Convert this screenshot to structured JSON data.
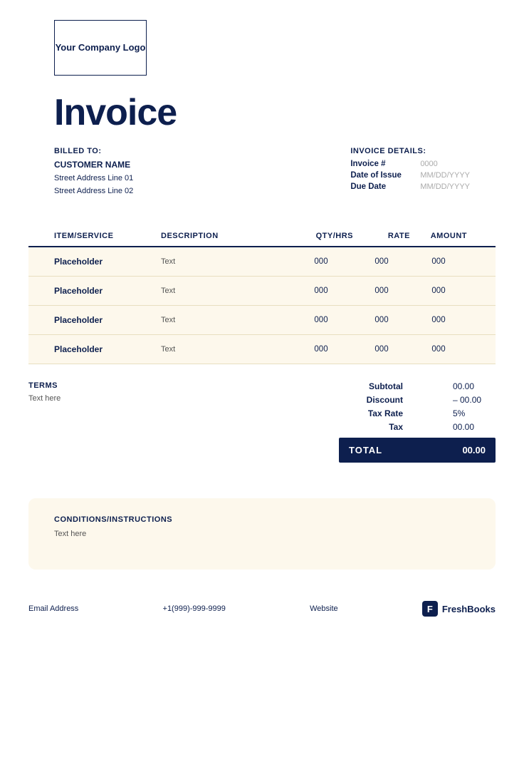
{
  "logo": {
    "text": "Your Company Logo"
  },
  "invoice": {
    "title": "Invoice"
  },
  "billed_to": {
    "label": "BILLED TO:",
    "customer_name": "CUSTOMER NAME",
    "address_line1": "Street Address Line 01",
    "address_line2": "Street Address Line 02"
  },
  "invoice_details": {
    "label": "INVOICE DETAILS:",
    "number_key": "Invoice #",
    "number_val": "0000",
    "issue_key": "Date of Issue",
    "issue_val": "MM/DD/YYYY",
    "due_key": "Due Date",
    "due_val": "MM/DD/YYYY"
  },
  "table": {
    "headers": [
      "ITEM/SERVICE",
      "DESCRIPTION",
      "QTY/HRS",
      "RATE",
      "AMOUNT"
    ],
    "rows": [
      {
        "item": "Placeholder",
        "description": "Text",
        "qty": "000",
        "rate": "000",
        "amount": "000"
      },
      {
        "item": "Placeholder",
        "description": "Text",
        "qty": "000",
        "rate": "000",
        "amount": "000"
      },
      {
        "item": "Placeholder",
        "description": "Text",
        "qty": "000",
        "rate": "000",
        "amount": "000"
      },
      {
        "item": "Placeholder",
        "description": "Text",
        "qty": "000",
        "rate": "000",
        "amount": "000"
      }
    ]
  },
  "terms": {
    "label": "TERMS",
    "text": "Text here"
  },
  "totals": {
    "subtotal_key": "Subtotal",
    "subtotal_val": "00.00",
    "discount_key": "Discount",
    "discount_val": "– 00.00",
    "tax_rate_key": "Tax Rate",
    "tax_rate_val": "5%",
    "tax_key": "Tax",
    "tax_val": "00.00",
    "total_key": "TOTAL",
    "total_val": "00.00"
  },
  "conditions": {
    "label": "CONDITIONS/INSTRUCTIONS",
    "text": "Text here"
  },
  "footer": {
    "email": "Email Address",
    "phone": "+1(999)-999-9999",
    "website": "Website",
    "brand": "FreshBooks",
    "brand_icon": "F"
  }
}
